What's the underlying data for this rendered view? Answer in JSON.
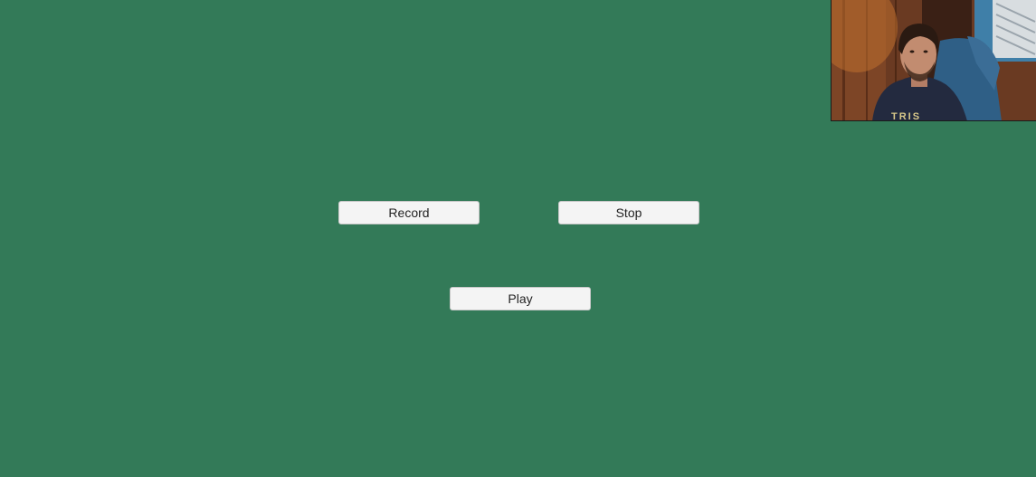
{
  "buttons": {
    "record_label": "Record",
    "stop_label": "Stop",
    "play_label": "Play"
  },
  "webcam": {
    "overlay_text": "TRIS"
  },
  "colors": {
    "background": "#337a58",
    "button_bg": "#f4f4f4"
  }
}
